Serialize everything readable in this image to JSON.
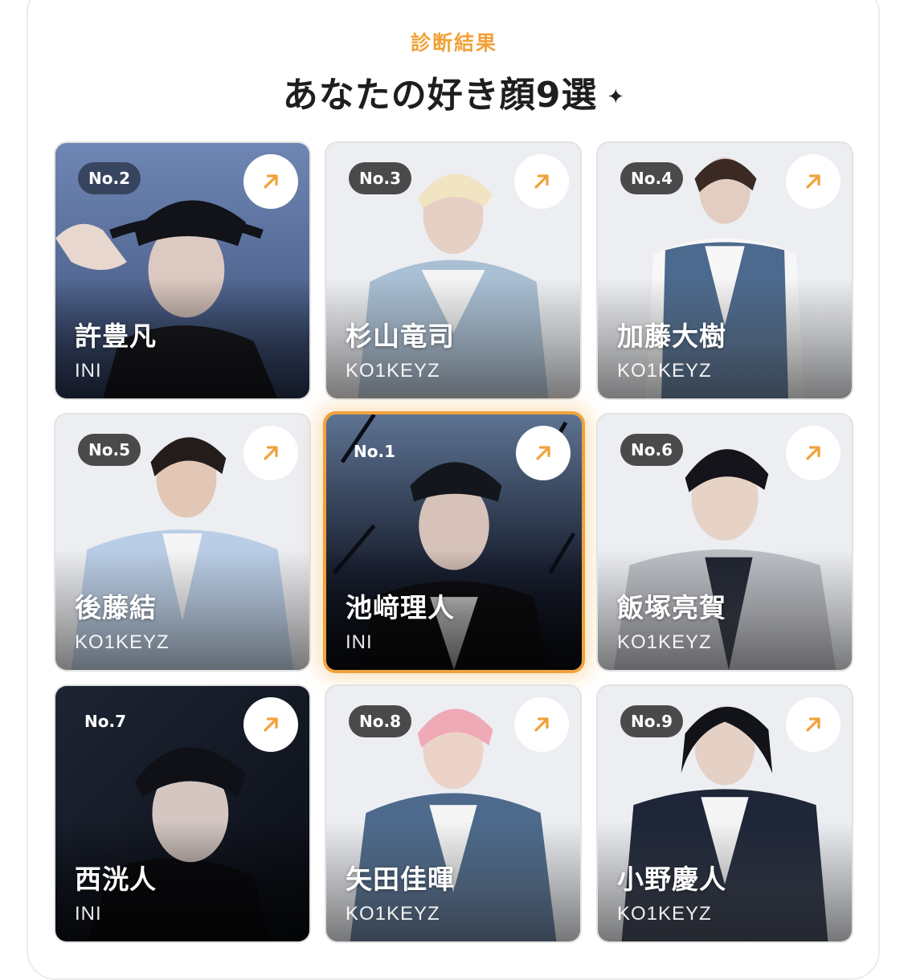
{
  "header": {
    "subtitle": "診断結果",
    "title": "あなたの好き顔9選",
    "sparkle": "✦"
  },
  "colors": {
    "accent": "#f0a23a",
    "badge": "#4a4a4a"
  },
  "cards": [
    {
      "rank": "No.2",
      "name": "許豊凡",
      "group": "INI",
      "style": "blue"
    },
    {
      "rank": "No.3",
      "name": "杉山竜司",
      "group": "KO1KEYZ",
      "style": "light"
    },
    {
      "rank": "No.4",
      "name": "加藤大樹",
      "group": "KO1KEYZ",
      "style": "light"
    },
    {
      "rank": "No.5",
      "name": "後藤結",
      "group": "KO1KEYZ",
      "style": "light"
    },
    {
      "rank": "No.1",
      "name": "池﨑理人",
      "group": "INI",
      "style": "top-pick"
    },
    {
      "rank": "No.6",
      "name": "飯塚亮賀",
      "group": "KO1KEYZ",
      "style": "light"
    },
    {
      "rank": "No.7",
      "name": "西洸人",
      "group": "INI",
      "style": "dark"
    },
    {
      "rank": "No.8",
      "name": "矢田佳暉",
      "group": "KO1KEYZ",
      "style": "light"
    },
    {
      "rank": "No.9",
      "name": "小野慶人",
      "group": "KO1KEYZ",
      "style": "light"
    }
  ]
}
